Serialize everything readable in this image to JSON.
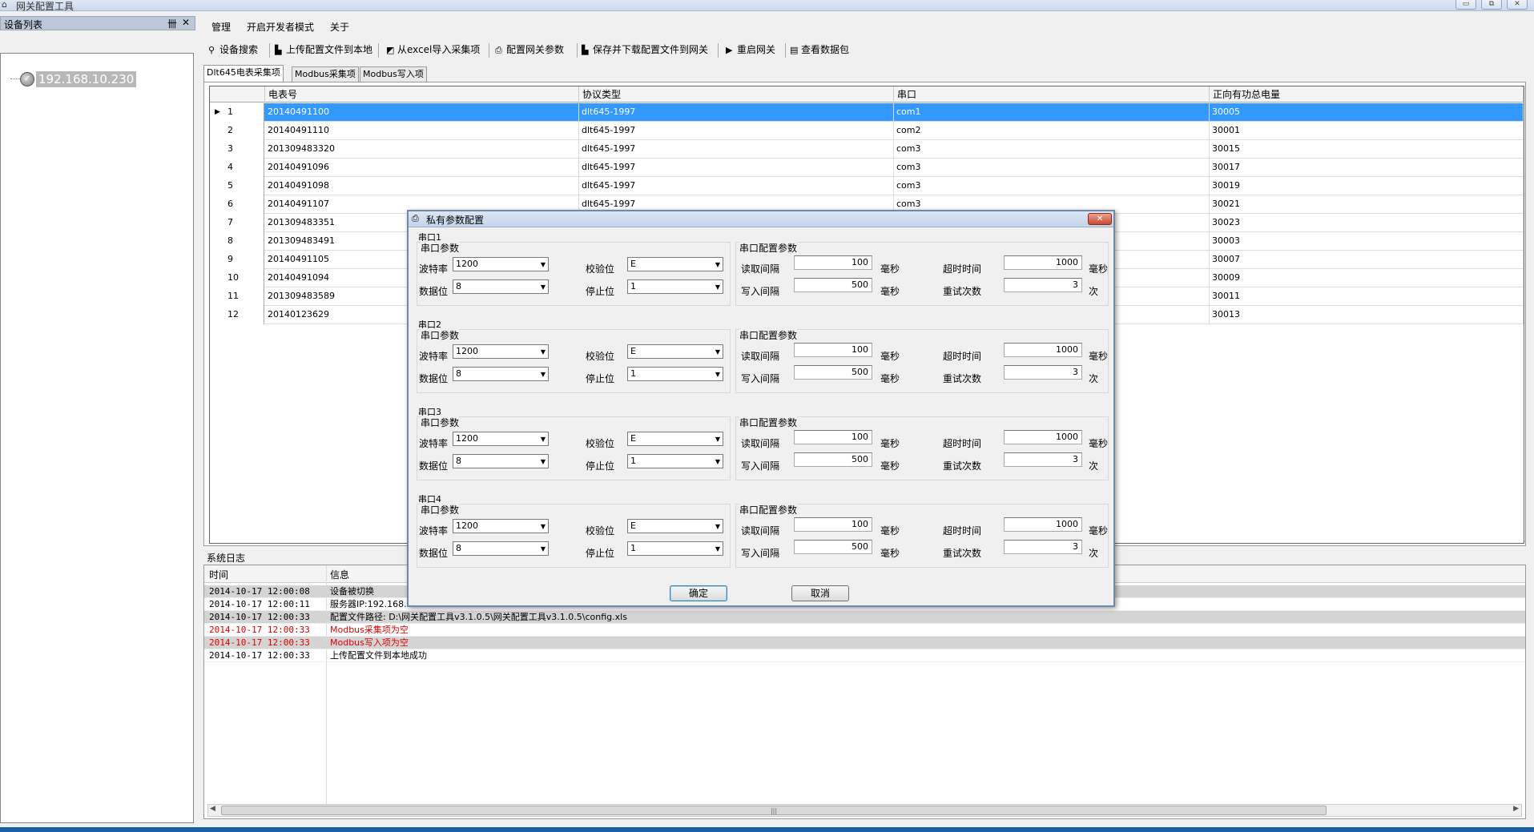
{
  "window": {
    "title": "网关配置工具",
    "min": "▭",
    "max": "⧉",
    "close": "✕"
  },
  "left_panel": {
    "title": "设备列表",
    "pin": "卌",
    "close": "✕",
    "device_ip": "192.168.10.230"
  },
  "menu": [
    "管理",
    "开启开发者模式",
    "关于"
  ],
  "toolbar": [
    {
      "icon": "search-icon",
      "label": "设备搜索"
    },
    {
      "icon": "upload-icon",
      "label": "上传配置文件到本地"
    },
    {
      "icon": "excel-icon",
      "label": "从excel导入采集项"
    },
    {
      "icon": "gateway-config-icon",
      "label": "配置网关参数"
    },
    {
      "icon": "save-download-icon",
      "label": "保存并下载配置文件到网关"
    },
    {
      "icon": "play-icon",
      "label": "重启网关"
    },
    {
      "icon": "document-icon",
      "label": "查看数据包"
    }
  ],
  "tabs": [
    "Dlt645电表采集项",
    "Modbus采集项",
    "Modbus写入项"
  ],
  "grid": {
    "headers": [
      "电表号",
      "协议类型",
      "串口",
      "正向有功总电量"
    ],
    "rows": [
      {
        "n": "1",
        "meter": "20140491100",
        "protocol": "dlt645-1997",
        "port": "com1",
        "energy": "30005"
      },
      {
        "n": "2",
        "meter": "20140491110",
        "protocol": "dlt645-1997",
        "port": "com2",
        "energy": "30001"
      },
      {
        "n": "3",
        "meter": "201309483320",
        "protocol": "dlt645-1997",
        "port": "com3",
        "energy": "30015"
      },
      {
        "n": "4",
        "meter": "20140491096",
        "protocol": "dlt645-1997",
        "port": "com3",
        "energy": "30017"
      },
      {
        "n": "5",
        "meter": "20140491098",
        "protocol": "dlt645-1997",
        "port": "com3",
        "energy": "30019"
      },
      {
        "n": "6",
        "meter": "20140491107",
        "protocol": "dlt645-1997",
        "port": "com3",
        "energy": "30021"
      },
      {
        "n": "7",
        "meter": "201309483351",
        "protocol": "",
        "port": "",
        "energy": "30023"
      },
      {
        "n": "8",
        "meter": "201309483491",
        "protocol": "",
        "port": "",
        "energy": "30003"
      },
      {
        "n": "9",
        "meter": "20140491105",
        "protocol": "",
        "port": "",
        "energy": "30007"
      },
      {
        "n": "10",
        "meter": "20140491094",
        "protocol": "",
        "port": "",
        "energy": "30009"
      },
      {
        "n": "11",
        "meter": "201309483589",
        "protocol": "",
        "port": "",
        "energy": "30011"
      },
      {
        "n": "12",
        "meter": "20140123629",
        "protocol": "",
        "port": "",
        "energy": "30013"
      }
    ]
  },
  "log": {
    "label": "系统日志",
    "headers": [
      "时间",
      "信息"
    ],
    "rows": [
      {
        "time": "2014-10-17 12:00:08",
        "msg": "设备被切换",
        "err": false
      },
      {
        "time": "2014-10-17 12:00:11",
        "msg": "服务器IP:192.168.10.230",
        "err": false
      },
      {
        "time": "2014-10-17 12:00:33",
        "msg": "配置文件路径: D:\\网关配置工具v3.1.0.5\\网关配置工具v3.1.0.5\\config.xls",
        "err": false
      },
      {
        "time": "2014-10-17 12:00:33",
        "msg": "Modbus采集项为空",
        "err": true
      },
      {
        "time": "2014-10-17 12:00:33",
        "msg": "Modbus写入项为空",
        "err": true
      },
      {
        "time": "2014-10-17 12:00:33",
        "msg": "上传配置文件到本地成功",
        "err": false
      }
    ],
    "scroll_grip": "|||"
  },
  "dialog": {
    "title": "私有参数配置",
    "icon": "printer-icon",
    "labels": {
      "serial_params": "串口参数",
      "serial_config": "串口配置参数",
      "baud": "波特率",
      "parity": "校验位",
      "databits": "数据位",
      "stopbits": "停止位",
      "read_interval": "读取间隔",
      "write_interval": "写入间隔",
      "timeout": "超时时间",
      "retries": "重试次数",
      "ms": "毫秒",
      "times": "次"
    },
    "ports": [
      {
        "name": "串口1",
        "baud": "1200",
        "parity": "E",
        "databits": "8",
        "stopbits": "1",
        "read": "100",
        "write": "500",
        "timeout": "1000",
        "retries": "3"
      },
      {
        "name": "串口2",
        "baud": "1200",
        "parity": "E",
        "databits": "8",
        "stopbits": "1",
        "read": "100",
        "write": "500",
        "timeout": "1000",
        "retries": "3"
      },
      {
        "name": "串口3",
        "baud": "1200",
        "parity": "E",
        "databits": "8",
        "stopbits": "1",
        "read": "100",
        "write": "500",
        "timeout": "1000",
        "retries": "3"
      },
      {
        "name": "串口4",
        "baud": "1200",
        "parity": "E",
        "databits": "8",
        "stopbits": "1",
        "read": "100",
        "write": "500",
        "timeout": "1000",
        "retries": "3"
      }
    ],
    "ok": "确定",
    "cancel": "取消"
  }
}
